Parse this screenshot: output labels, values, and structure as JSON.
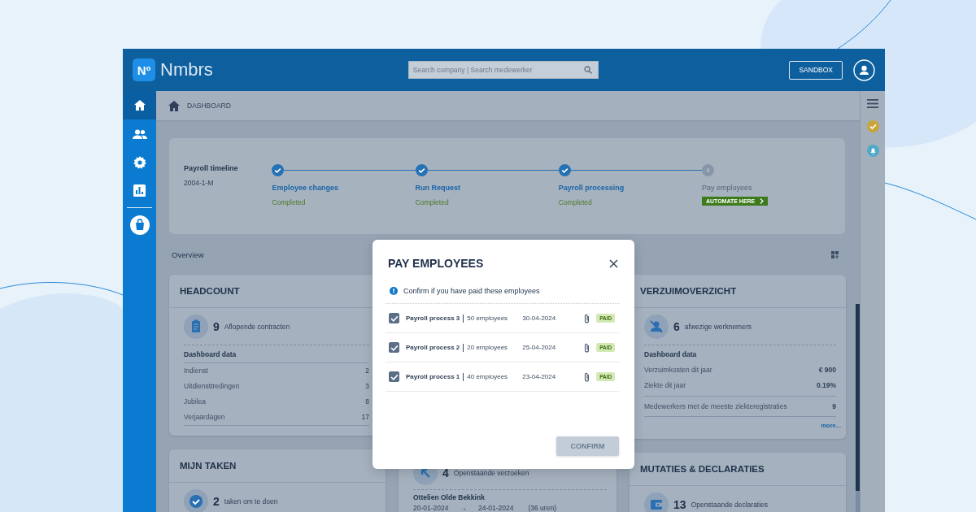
{
  "brand": {
    "logo": "Nº",
    "name": "Nmbrs"
  },
  "search": {
    "placeholder": "Search company | Search medewerker"
  },
  "sandbox_button": "SANDBOX",
  "sidebar": {
    "items": [
      {
        "kind": "home",
        "selected": true
      },
      {
        "kind": "people",
        "selected": false
      },
      {
        "kind": "settings",
        "selected": false
      },
      {
        "kind": "chart",
        "selected": false
      },
      {
        "kind": "shop",
        "selected": false
      }
    ]
  },
  "breadcrumb": "DASHBOARD",
  "timeline": {
    "title": "Payroll timeline",
    "period": "2004-1-M",
    "steps": [
      {
        "label": "Employee changes",
        "status": "Completed",
        "completed": true
      },
      {
        "label": "Run Request",
        "status": "Completed",
        "completed": true
      },
      {
        "label": "Payroll processing",
        "status": "Completed",
        "completed": true
      },
      {
        "number": "4",
        "label": "Pay employees",
        "completed": false,
        "action": "AUTOMATE HERE"
      }
    ]
  },
  "overview_label": "Overview",
  "columns": [
    [
      {
        "title": "HEADCOUNT",
        "stat": {
          "kind": "clipboard",
          "count": "9",
          "label": "Aflopende contracten"
        },
        "section_title": "Dashboard data",
        "section_rule": true,
        "values_bold": false,
        "rows": [
          {
            "label": "Indienst",
            "value": "2",
            "separated": false
          },
          {
            "label": "Uitdiensttredingen",
            "value": "3",
            "separated": false
          },
          {
            "label": "Jubilea",
            "value": "8",
            "separated": false
          },
          {
            "label": "Verjaardagen",
            "value": "17",
            "separated": false
          }
        ]
      },
      {
        "title": "MIJN TAKEN",
        "stat": {
          "kind": "check",
          "count": "2",
          "label": "taken om te doen"
        }
      }
    ],
    [
      {
        "stat": {
          "kind": "arrow",
          "count": "4",
          "label": "Openstaande verzoeken"
        },
        "request": {
          "name": "Ottelien Olde Bekkink",
          "from": "20-01-2024",
          "arrow": "→",
          "to": "24-01-2024",
          "hours": "(36 uren)"
        }
      }
    ],
    [
      {
        "title": "VERZUIMOVERZICHT",
        "stat": {
          "kind": "person-off",
          "count": "6",
          "label": "afwezige werknemers"
        },
        "section_title": "Dashboard data",
        "section_rule": false,
        "values_bold": true,
        "rows": [
          {
            "label": "Verzuimkosten dit jaar",
            "value": "€ 900",
            "separated": false
          },
          {
            "label": "Ziekte dit jaar",
            "value": "0.19%",
            "separated": false
          },
          {
            "label": "Medewerkers met de meeste ziekteregistraties",
            "value": "9",
            "separated": true
          }
        ],
        "more": "more..."
      },
      {
        "title": "MUTATIES & DECLARATIES",
        "stat": {
          "kind": "wallet",
          "count": "13",
          "label": "Openstaande declaraties"
        }
      }
    ]
  ],
  "right_rail": [
    {
      "kind": "menu"
    },
    {
      "kind": "check"
    },
    {
      "kind": "bell"
    }
  ],
  "modal": {
    "title": "PAY EMPLOYEES",
    "info": "Confirm if you have paid these employees",
    "rows": [
      {
        "process": "Payroll process 3",
        "employees": "50 employees",
        "date": "30-04-2024",
        "status": "PAID",
        "checked": true
      },
      {
        "process": "Payroll process 2",
        "employees": "20 employees",
        "date": "25-04-2024",
        "status": "PAID",
        "checked": true
      },
      {
        "process": "Payroll process 1",
        "employees": "40 employees",
        "date": "23-04-2024",
        "status": "PAID",
        "checked": true
      }
    ],
    "confirm_button": "CONFIRM"
  }
}
